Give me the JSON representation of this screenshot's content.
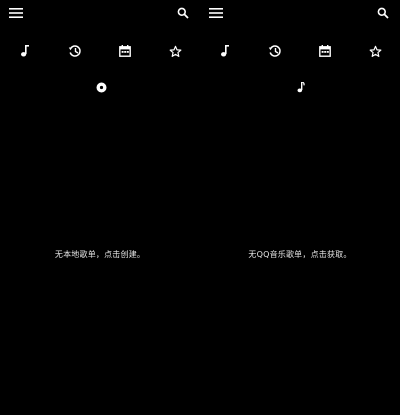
{
  "colors": {
    "background": "#000000",
    "icon": "#ffffff",
    "text": "#e6e6e6"
  },
  "icons": {
    "menu": "hamburger-menu",
    "search": "magnifier",
    "tabs": [
      "music-note",
      "history-clock",
      "calendar",
      "star"
    ]
  },
  "left_panel": {
    "indicator": "disc-icon",
    "empty_message": "无本地歌单，点击创建。"
  },
  "right_panel": {
    "indicator": "music-note-icon",
    "empty_message": "无QQ音乐歌单，点击获取。"
  }
}
